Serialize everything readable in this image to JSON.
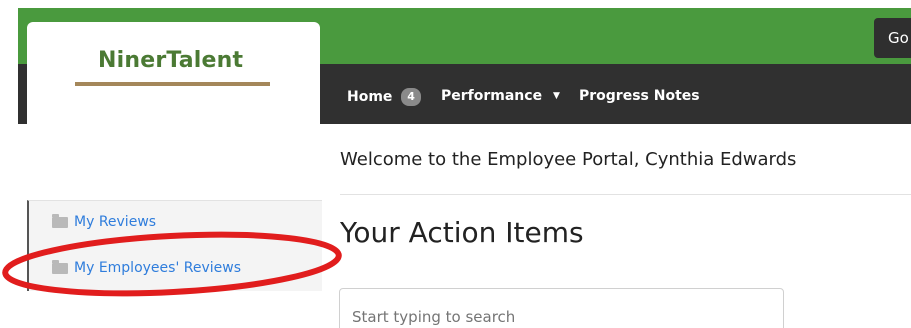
{
  "header": {
    "top_button_label": "Go"
  },
  "logo": {
    "text": "NinerTalent"
  },
  "nav": {
    "items": [
      {
        "label": "Home",
        "badge": "4"
      },
      {
        "label": "Performance"
      },
      {
        "label": "Progress Notes"
      }
    ]
  },
  "sidebar": {
    "items": [
      {
        "label": "My Reviews"
      },
      {
        "label": "My Employees' Reviews"
      }
    ]
  },
  "main": {
    "welcome": "Welcome to the Employee Portal, Cynthia Edwards",
    "section_title": "Your Action Items",
    "search_placeholder": "Start typing to search"
  },
  "colors": {
    "header_green": "#4a9a3e",
    "nav_dark": "#303030",
    "link_blue": "#2f7ddc",
    "highlight_red": "#e11d1d"
  }
}
